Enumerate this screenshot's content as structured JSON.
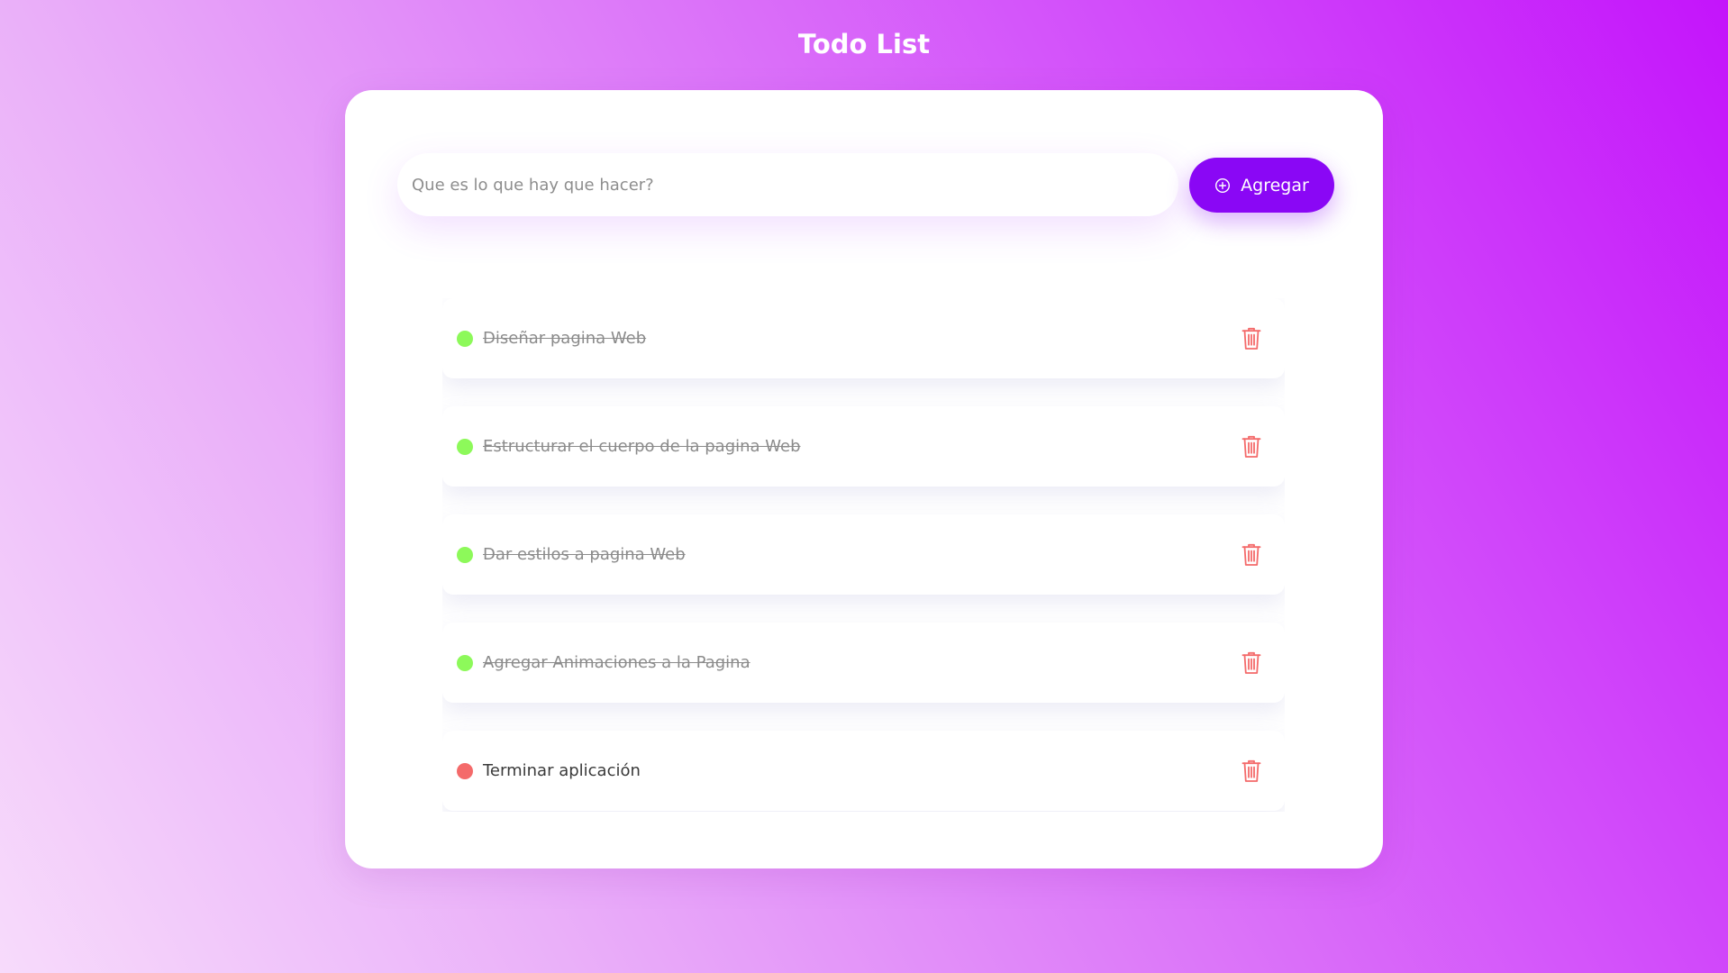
{
  "header": {
    "title": "Todo List"
  },
  "composer": {
    "placeholder": "Que es lo que hay que hacer?",
    "value": "",
    "add_button_label": "Agregar",
    "add_button_icon": "plus-circle-icon"
  },
  "todos": [
    {
      "text": "Diseñar pagina Web",
      "done": true
    },
    {
      "text": "Estructurar el cuerpo de la pagina Web",
      "done": true
    },
    {
      "text": "Dar estilos a pagina Web",
      "done": true
    },
    {
      "text": "Agregar Animaciones a la Pagina",
      "done": true
    },
    {
      "text": "Terminar aplicación",
      "done": false
    }
  ],
  "colors": {
    "accent": "#8a07f5",
    "done_dot": "#8df95a",
    "pending_dot": "#f46a6a",
    "delete_icon": "#f46a6a"
  },
  "icons": {
    "delete": "trash-icon"
  }
}
